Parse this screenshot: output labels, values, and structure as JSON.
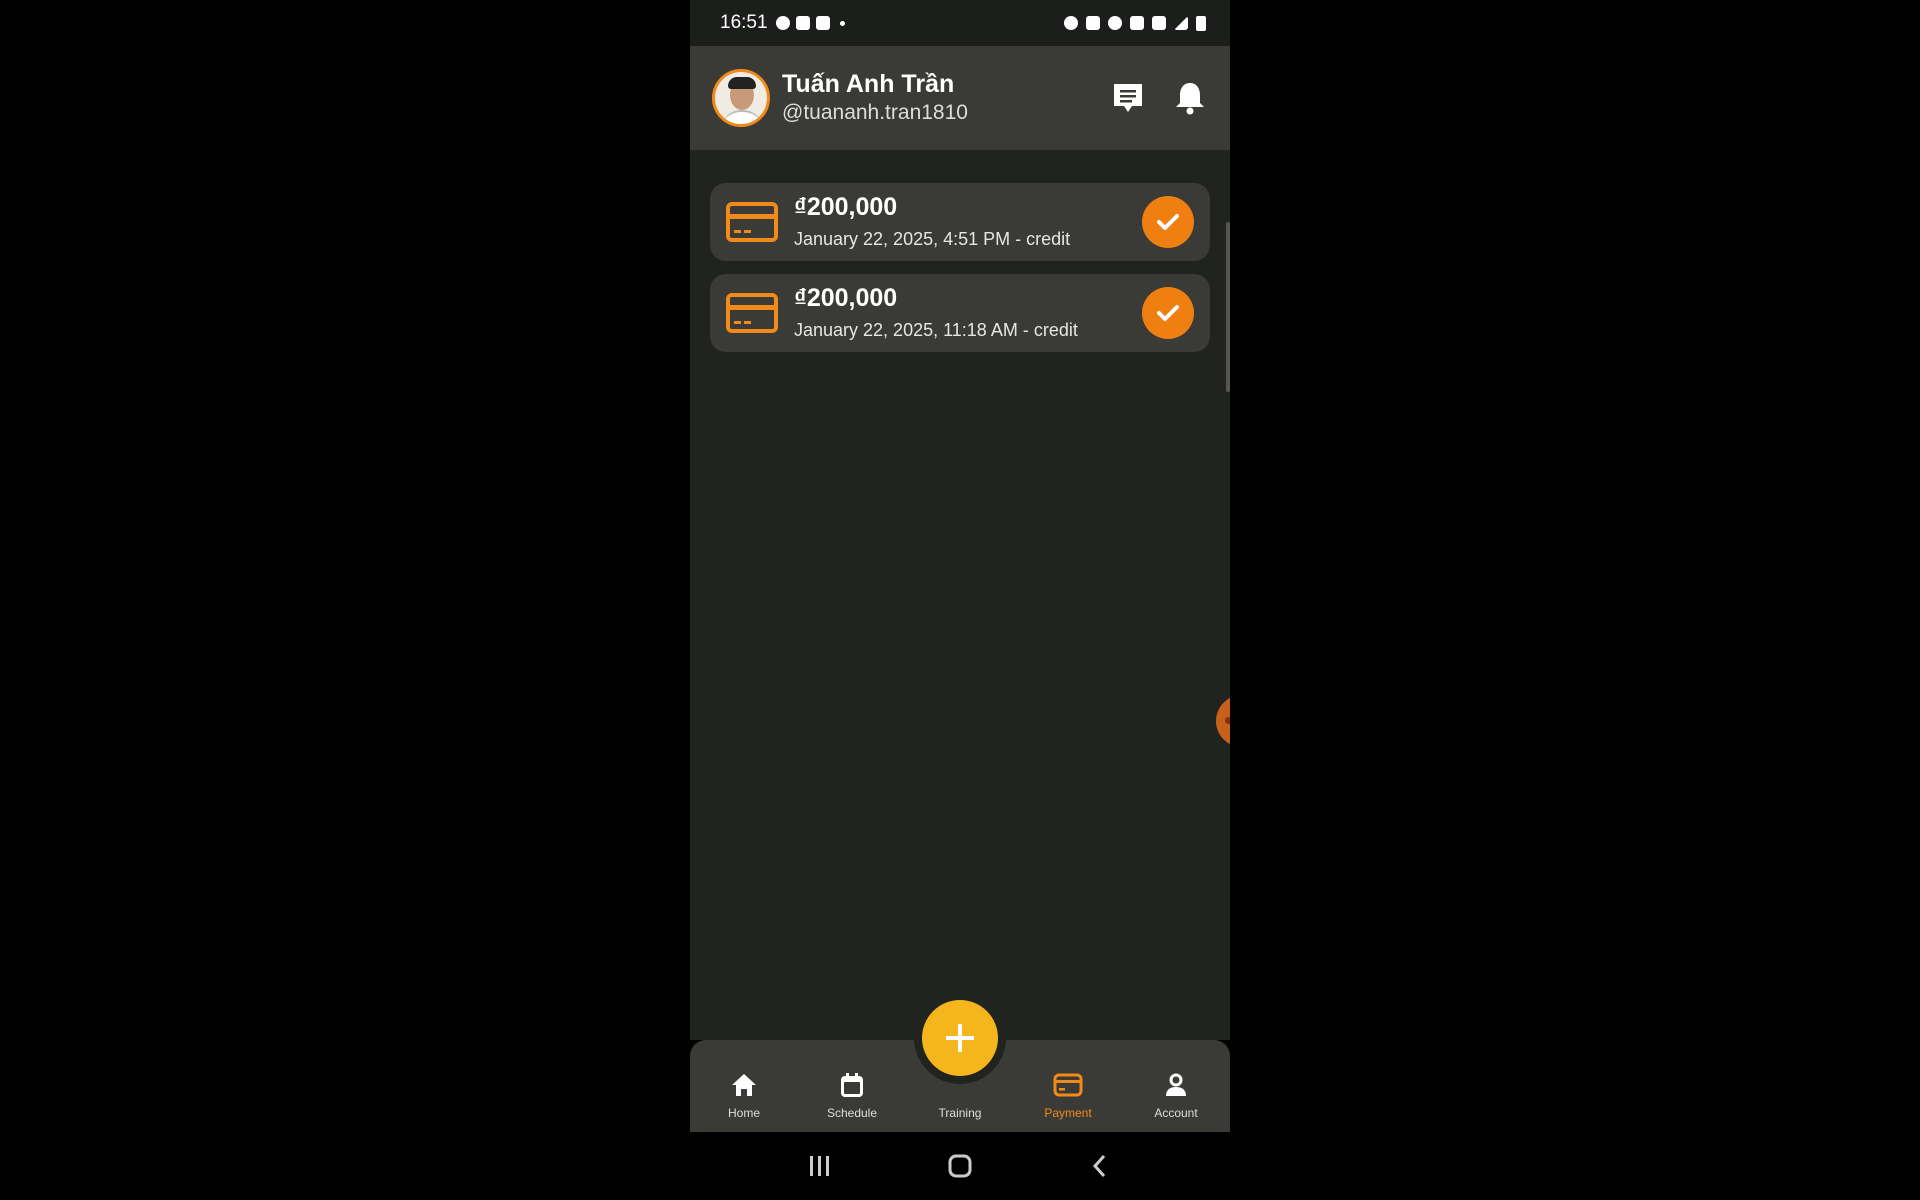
{
  "status_bar": {
    "time": "16:51",
    "icons_left": [
      "messenger-icon",
      "gallery-icon",
      "video-icon",
      "dot-icon"
    ],
    "icons_right": [
      "alarm-icon",
      "mute-icon",
      "hotspot-icon",
      "volte-icon",
      "4g-icon",
      "signal-icon",
      "battery-icon"
    ]
  },
  "header": {
    "user_name": "Tuấn Anh Trần",
    "user_handle": "@tuananh.tran1810",
    "icons": [
      "chat-icon",
      "bell-icon"
    ]
  },
  "payments": [
    {
      "amount": "₫200,000",
      "details": "January 22, 2025, 4:51 PM - credit",
      "status": "completed"
    },
    {
      "amount": "₫200,000",
      "details": "January 22, 2025, 11:18 AM - credit",
      "status": "completed"
    }
  ],
  "bottom_nav": {
    "items": [
      {
        "label": "Home",
        "icon": "home-icon",
        "active": false
      },
      {
        "label": "Schedule",
        "icon": "calendar-icon",
        "active": false
      },
      {
        "label": "Training",
        "icon": "plus-icon",
        "active": false
      },
      {
        "label": "Payment",
        "icon": "card-icon",
        "active": true
      },
      {
        "label": "Account",
        "icon": "user-icon",
        "active": false
      }
    ]
  },
  "colors": {
    "accent": "#f28a1a",
    "fab": "#f5b51c",
    "surface": "#3a3b37",
    "background": "#21231f"
  }
}
